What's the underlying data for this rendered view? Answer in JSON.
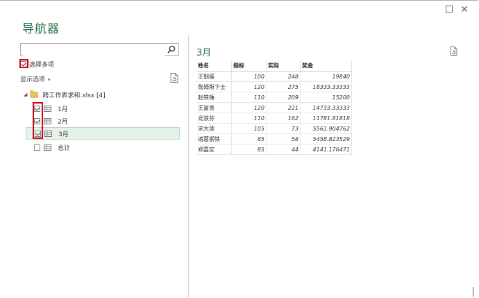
{
  "window": {
    "title": "导航器"
  },
  "search": {
    "value": "",
    "placeholder": ""
  },
  "multi_select": {
    "label": "选择多项",
    "checked": true
  },
  "display_options": {
    "label": "显示选项",
    "arrow": "▾"
  },
  "tree": {
    "folder": {
      "expand_glyph": "◢",
      "label": "跨工作表求和.xlsx [4]"
    },
    "items": [
      {
        "label": "1月",
        "checked": true,
        "selected": false
      },
      {
        "label": "2月",
        "checked": true,
        "selected": false
      },
      {
        "label": "3月",
        "checked": true,
        "selected": true
      },
      {
        "label": "总计",
        "checked": false,
        "selected": false
      }
    ]
  },
  "preview": {
    "title": "3月",
    "columns": [
      "姓名",
      "指标",
      "实际",
      "奖金"
    ],
    "rows": [
      [
        "王钢蛋",
        "100",
        "248",
        "19840"
      ],
      [
        "詹姆斯下士",
        "120",
        "275",
        "18333.33333"
      ],
      [
        "赵铁锤",
        "110",
        "209",
        "15200"
      ],
      [
        "王富贵",
        "120",
        "221",
        "14733.33333"
      ],
      [
        "龙浪芬",
        "110",
        "162",
        "11781.81818"
      ],
      [
        "宋大莲",
        "105",
        "73",
        "5561.904762"
      ],
      [
        "诸葛钢铁",
        "85",
        "58",
        "5458.823529"
      ],
      [
        "郑嘉定",
        "85",
        "44",
        "4141.176471"
      ]
    ]
  },
  "icons": {
    "search": "search-icon",
    "refresh": "refresh-icon",
    "table": "table-icon",
    "folder": "folder-icon",
    "minimize": "minimize-icon",
    "close": "close-icon"
  },
  "colors": {
    "accent": "#217346",
    "highlight": "#d0021b",
    "selection": "#e6f2e9"
  }
}
